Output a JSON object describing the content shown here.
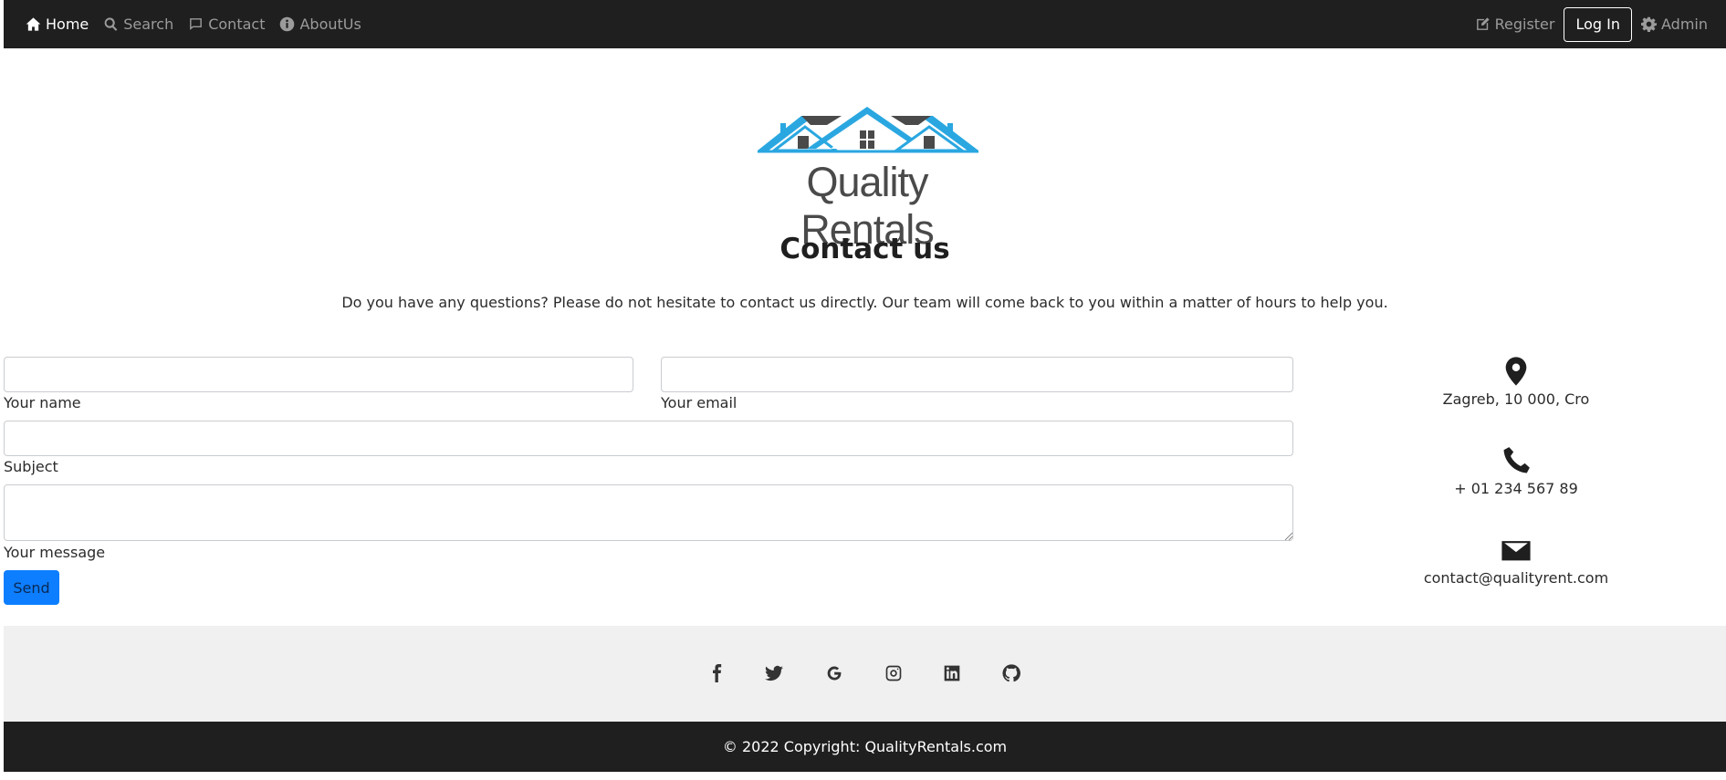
{
  "nav": {
    "items": [
      {
        "label": "Home",
        "icon": "home-icon"
      },
      {
        "label": "Search",
        "icon": "search-icon"
      },
      {
        "label": "Contact",
        "icon": "comment-icon"
      },
      {
        "label": "AboutUs",
        "icon": "info-icon"
      }
    ],
    "register": "Register",
    "login": "Log In",
    "admin": "Admin"
  },
  "brand": {
    "name": "Quality Rentals",
    "colors": {
      "roof_blue": "#2aa7e0",
      "roof_gray": "#4a4a4a"
    }
  },
  "page": {
    "title": "Contact us",
    "subtitle": "Do you have any questions? Please do not hesitate to contact us directly. Our team will come back to you within a matter of hours to help you."
  },
  "form": {
    "name_label": "Your name",
    "name_value": "",
    "email_label": "Your email",
    "email_value": "",
    "subject_label": "Subject",
    "subject_value": "",
    "message_label": "Your message",
    "message_value": "",
    "send_label": "Send"
  },
  "contact": {
    "address": "Zagreb, 10 000, Cro",
    "phone": "+ 01 234 567 89",
    "email": "contact@qualityrent.com"
  },
  "social": [
    "facebook-icon",
    "twitter-icon",
    "google-icon",
    "instagram-icon",
    "linkedin-icon",
    "github-icon"
  ],
  "footer": {
    "copyright": "© 2022 Copyright: QualityRentals.com"
  },
  "colors": {
    "navbar_bg": "#1f1f1f",
    "accent_button": "#0d7eff",
    "social_bg": "#f0f0f0"
  }
}
